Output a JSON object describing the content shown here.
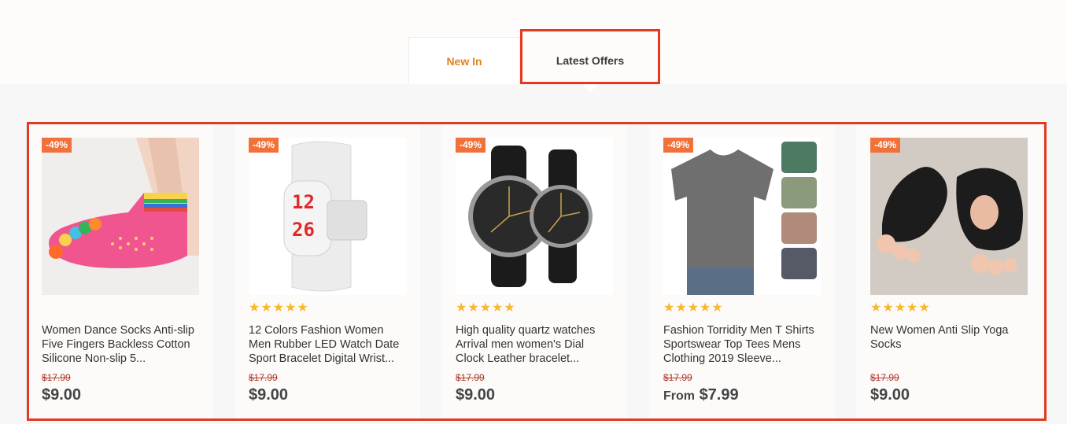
{
  "tabs": {
    "new_in": "New In",
    "latest_offers": "Latest Offers"
  },
  "colors": {
    "accent": "#e0831f",
    "badge": "#f0713a",
    "stars": "#f5b82e",
    "highlight": "#e23a22"
  },
  "products": [
    {
      "badge": "-49%",
      "stars": "",
      "title": "Women Dance Socks Anti-slip Five Fingers Backless Cotton Silicone Non-slip 5...",
      "old_price": "$17.99",
      "price_prefix": "",
      "price": "$9.00",
      "image_icon": "toe-socks-image"
    },
    {
      "badge": "-49%",
      "stars": "★★★★★",
      "title": "12 Colors Fashion Women Men Rubber LED Watch Date Sport Bracelet Digital Wrist...",
      "old_price": "$17.99",
      "price_prefix": "",
      "price": "$9.00",
      "image_icon": "led-watch-image"
    },
    {
      "badge": "-49%",
      "stars": "★★★★★",
      "title": "High quality quartz watches Arrival men women's Dial Clock Leather bracelet...",
      "old_price": "$17.99",
      "price_prefix": "",
      "price": "$9.00",
      "image_icon": "quartz-watches-image"
    },
    {
      "badge": "-49%",
      "stars": "★★★★★",
      "title": "Fashion Torridity Men T Shirts Sportswear Top Tees Mens Clothing 2019 Sleeve...",
      "old_price": "$17.99",
      "price_prefix": "From",
      "price": "$7.99",
      "image_icon": "tshirt-image"
    },
    {
      "badge": "-49%",
      "stars": "★★★★★",
      "title": "New Women Anti Slip Yoga Socks",
      "old_price": "$17.99",
      "price_prefix": "",
      "price": "$9.00",
      "image_icon": "yoga-socks-image"
    }
  ]
}
